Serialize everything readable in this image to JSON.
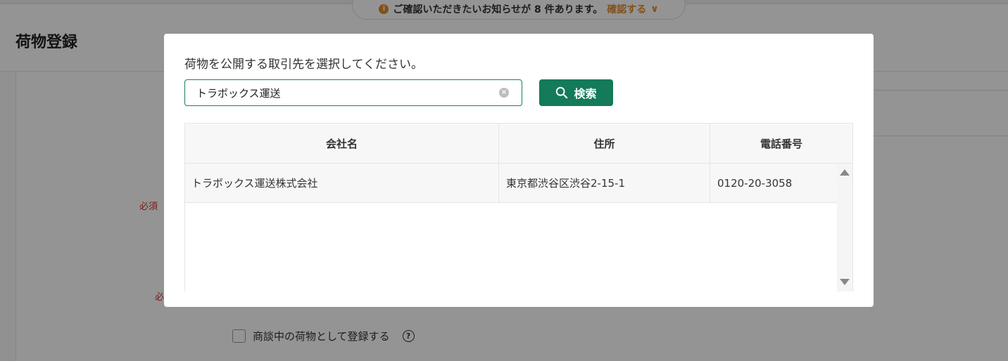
{
  "background": {
    "notice_text": "ご確認いただきたいお知らせが 8 件あります。",
    "notice_link": "確認する",
    "page_title": "荷物登録",
    "required_label": "必須",
    "required_label_2": "必",
    "negotiation_checkbox_label": "商談中の荷物として登録する"
  },
  "modal": {
    "prompt": "荷物を公開する取引先を選択してください。",
    "search_value": "トラボックス運送",
    "search_button_label": "検索",
    "table": {
      "headers": [
        "会社名",
        "住所",
        "電話番号"
      ],
      "rows": [
        [
          "トラボックス運送株式会社",
          "東京都渋谷区渋谷2-15-1",
          "0120-20-3058"
        ]
      ]
    }
  }
}
